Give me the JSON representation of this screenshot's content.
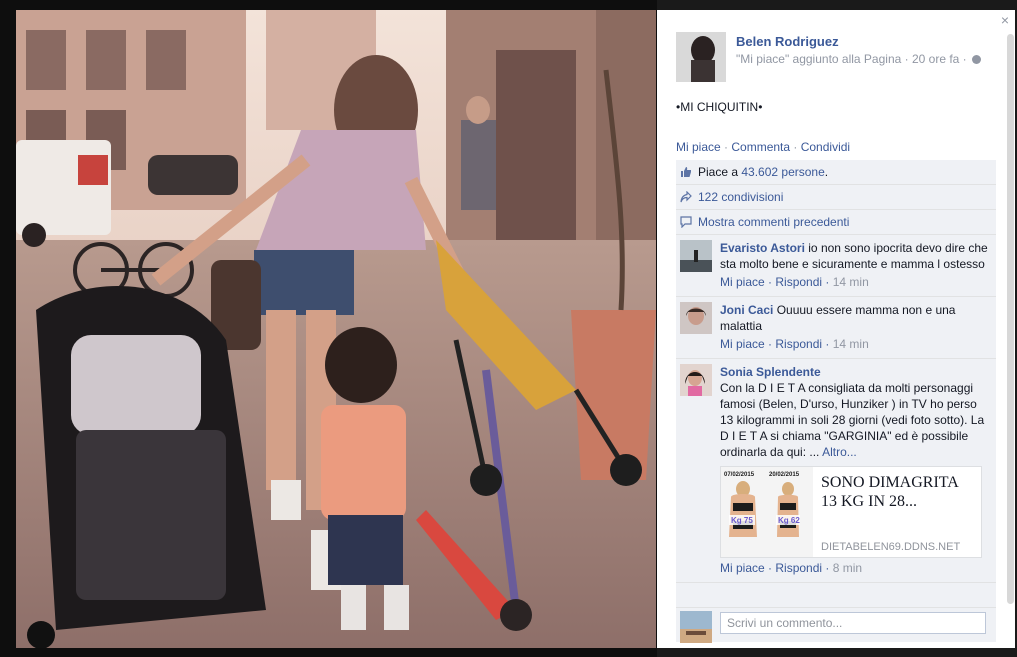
{
  "post": {
    "page_name": "Belen Rodriguez",
    "action_text": "\"Mi piace\" aggiunto alla Pagina",
    "dot": " · ",
    "time_ago": "20 ore fa",
    "caption": "•MI CHIQUITIN•"
  },
  "actions": {
    "like": "Mi piace",
    "comment": "Commenta",
    "share": "Condividi",
    "sep": " · "
  },
  "feedback": {
    "likes_prefix": "Piace a",
    "likes_link": "43.602 persone",
    "likes_suffix": ".",
    "shares": "122 condivisioni",
    "show_previous": "Mostra commenti precedenti"
  },
  "comments": [
    {
      "author": "Evaristo Astori",
      "text": "io non sono ipocrita devo dire che sta molto bene e sicuramente e mamma l ostesso",
      "like": "Mi piace",
      "reply": "Rispondi",
      "time": "14 min"
    },
    {
      "author": "Joni Caci",
      "text": "Ouuuu essere mamma non e una malattia",
      "like": "Mi piace",
      "reply": "Rispondi",
      "time": "14 min"
    },
    {
      "author": "Sonia Splendente",
      "text": "Con la D I E T A consigliata da molti personaggi famosi (Belen, D'urso, Hunziker ) in TV ho perso 13 kilogrammi in soli 28 giorni (vedi foto sotto). La D I E T A si chiama \"GARGINIA\" ed è possibile ordinarla da qui: ...",
      "more": "Altro...",
      "link_title": "SONO DIMAGRITA 13 KG IN 28...",
      "link_domain": "DIETABELEN69.DDNS.NET",
      "thumb_date_1": "07/02/2015",
      "thumb_date_2": "20/02/2015",
      "thumb_kg_1": "Kg 75",
      "thumb_kg_2": "Kg 62",
      "like": "Mi piace",
      "reply": "Rispondi",
      "time": "8 min"
    }
  ],
  "composer": {
    "placeholder": "Scrivi un commento..."
  },
  "close_glyph": "×",
  "colors": {
    "link": "#3b5998",
    "meta": "#9197a3",
    "feedback_bg": "#eff1f5"
  }
}
